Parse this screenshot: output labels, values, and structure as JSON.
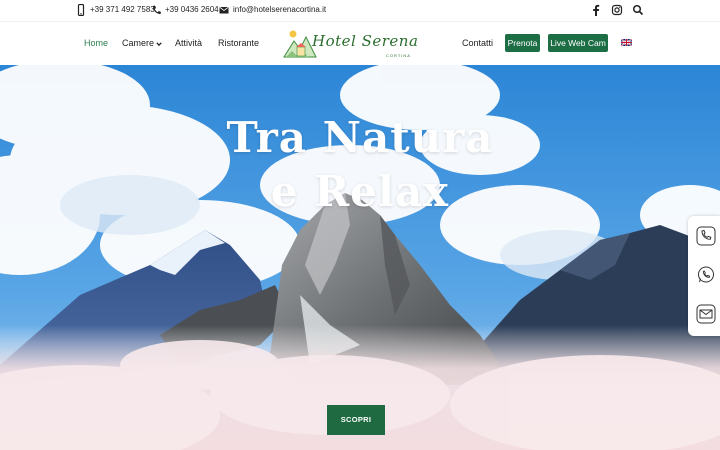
{
  "topbar": {
    "mobile": "+39 371 492 7583",
    "phone": "+39 0436 2604",
    "email": "info@hotelserenacortina.it",
    "social_icons": [
      "facebook-icon",
      "instagram-icon",
      "search-icon"
    ]
  },
  "nav": {
    "home": "Home",
    "camere": "Camere",
    "attivita": "Attività",
    "ristorante": "Ristorante",
    "contatti": "Contatti",
    "prenota": "Prenota",
    "webcam": "Live Web Cam",
    "language_flag": "uk-flag-icon"
  },
  "logo": {
    "name": "Hotel Serena",
    "sub": "CORTINA"
  },
  "hero": {
    "title_line1": "Tra Natura",
    "title_line2": "e Relax",
    "button": "SCOPRI"
  },
  "side_contacts": [
    "phone-icon",
    "whatsapp-icon",
    "mail-icon"
  ],
  "colors": {
    "brand_green": "#1e6e45",
    "active_link": "#2e7d4f",
    "sky": "#3c8fd6"
  }
}
